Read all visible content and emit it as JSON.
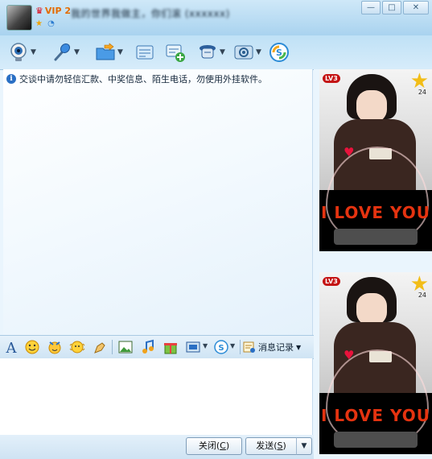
{
  "window": {
    "title": "我的世界我做主，你们滚 (xxxxxx)",
    "vip_label": "VIP 2",
    "buttons": {
      "minimize": "—",
      "maximize": "□",
      "close": "✕"
    }
  },
  "toolbar": {
    "items": [
      {
        "name": "video-call",
        "icon": "webcam-icon"
      },
      {
        "name": "voice-call",
        "icon": "microphone-icon"
      },
      {
        "name": "send-file",
        "icon": "folder-icon"
      },
      {
        "name": "send-sms",
        "icon": "message-icon"
      },
      {
        "name": "create-group",
        "icon": "group-add-icon"
      },
      {
        "name": "remote-assist",
        "icon": "assistance-icon"
      },
      {
        "name": "apps",
        "icon": "apps-icon"
      },
      {
        "name": "soso",
        "icon": "soso-icon"
      }
    ]
  },
  "chat": {
    "notice": "交谈中请勿轻信汇款、中奖信息、陌生电话，勿使用外挂软件。"
  },
  "format_bar": {
    "history_label": "消息记录"
  },
  "buttons": {
    "close_label": "关闭",
    "close_key": "C",
    "send_label": "发送",
    "send_key": "S"
  },
  "side_panel": {
    "shows": [
      {
        "level": "LV3",
        "stars": "24",
        "caption": "I LOVE YOU"
      },
      {
        "level": "LV3",
        "stars": "24",
        "caption": "I LOVE YOU"
      }
    ]
  },
  "colors": {
    "accent": "#2a6fc4",
    "titlebar": "#a9d3ef"
  }
}
